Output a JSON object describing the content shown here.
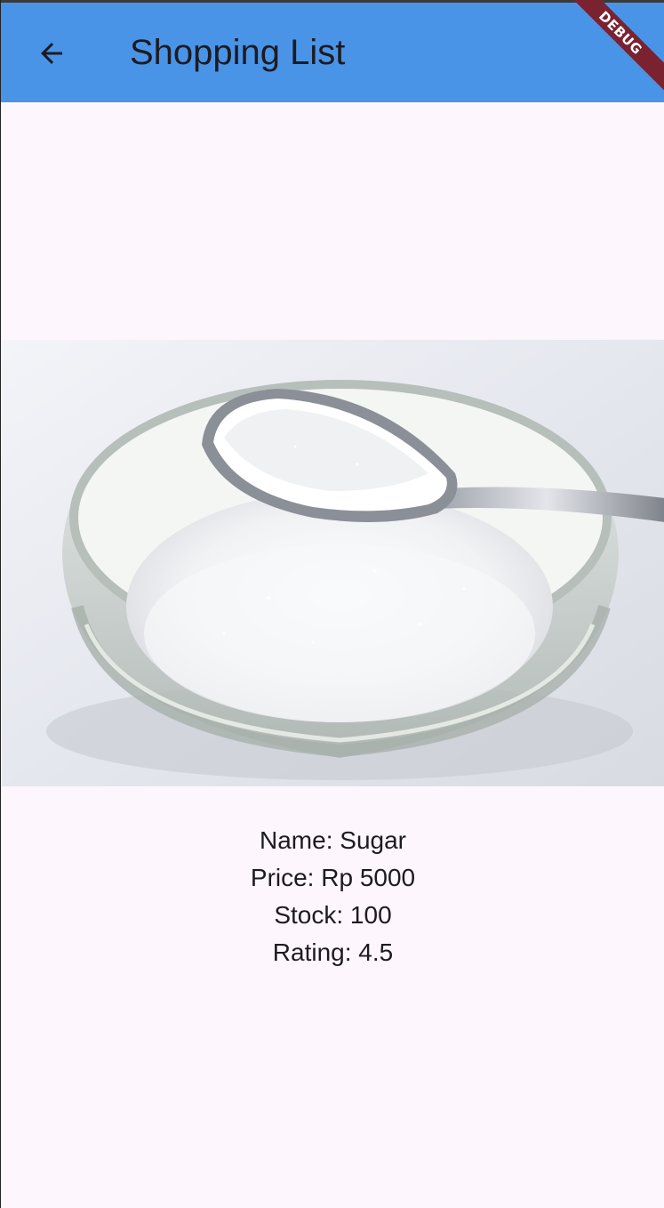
{
  "app_bar": {
    "title": "Shopping List",
    "back_icon": "arrow-back-icon",
    "background_color": "#4a94e8"
  },
  "debug_banner": {
    "label": "DEBUG",
    "color": "#7a2230"
  },
  "product": {
    "image_icon": "sugar-bowl-with-spoon-image",
    "name_line": "Name: Sugar",
    "price_line": "Price: Rp 5000",
    "stock_line": "Stock: 100",
    "rating_line": "Rating: 4.5"
  }
}
